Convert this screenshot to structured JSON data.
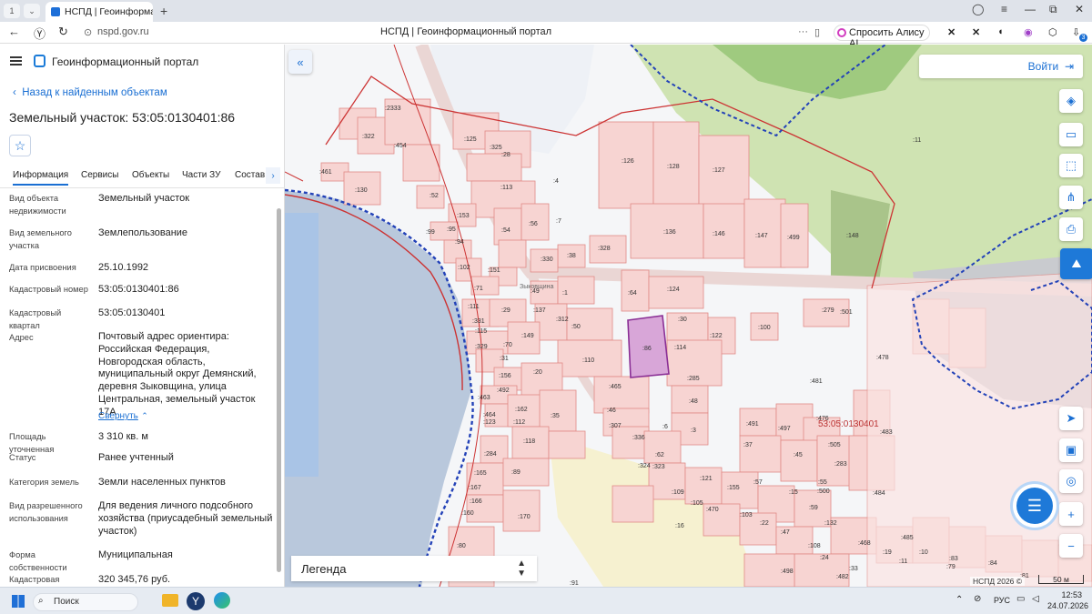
{
  "browser": {
    "tab_number": "1",
    "tab_title": "НСПД | Геоинформаци",
    "url": "nspd.gov.ru",
    "page_title": "НСПД | Геоинформационный портал",
    "alice_label": "Спросить Алису AI",
    "badge": "3"
  },
  "panel": {
    "portal_title": "Геоинформационный портал",
    "back_label": "Назад к найденным объектам",
    "object_title": "Земельный участок: 53:05:0130401:86",
    "tabs": [
      "Информация",
      "Сервисы",
      "Объекты",
      "Части ЗУ",
      "Состав"
    ],
    "fields": [
      {
        "label": "Вид объекта недвижимости",
        "value": "Земельный участок"
      },
      {
        "label": "Вид земельного участка",
        "value": "Землепользование"
      },
      {
        "label": "Дата присвоения",
        "value": "25.10.1992"
      },
      {
        "label": "Кадастровый номер",
        "value": "53:05:0130401:86"
      },
      {
        "label": "Кадастровый квартал",
        "value": "53:05:0130401"
      },
      {
        "label": "Адрес",
        "value": "Почтовый адрес ориентира: Российская Федерация, Новгородская область, муниципальный округ Демянский, деревня Зыковщина, улица Центральная, земельный участок 17А"
      },
      {
        "label": "Площадь уточненная",
        "value": "3 310 кв. м"
      },
      {
        "label": "Статус",
        "value": "Ранее учтенный"
      },
      {
        "label": "Категория земель",
        "value": "Земли населенных пунктов"
      },
      {
        "label": "Вид разрешенного использования",
        "value": "Для ведения личного подсобного хозяйства (приусадебный земельный участок)"
      },
      {
        "label": "Форма собственности",
        "value": "Муниципальная"
      },
      {
        "label": "Кадастровая",
        "value": "320 345,76 руб."
      }
    ],
    "collapse_label": "Свернуть"
  },
  "map": {
    "login_label": "Войти",
    "legend_label": "Легенда",
    "copyright": "НСПД 2026 ©",
    "scale": "50 м",
    "quarter_label": "53:05:0130401",
    "village_label": "Зыковщина",
    "parcels": [
      ":2333",
      ":322",
      ":454",
      ":125",
      ":325",
      ":28",
      ":461",
      ":130",
      ":113",
      ":4",
      ":126",
      ":128",
      ":127",
      ":11",
      ":52",
      ":153",
      ":56",
      ":7",
      ":99",
      ":95",
      ":54",
      ":94",
      ":136",
      ":146",
      ":147",
      ":499",
      ":148",
      ":328",
      ":330",
      ":38",
      ":102",
      ":151",
      ":71",
      ":49",
      ":1",
      ":64",
      ":124",
      ":279",
      ":501",
      ":111",
      ":331",
      ":29",
      ":137",
      ":312",
      ":50",
      ":30",
      ":122",
      ":100",
      ":115",
      ":329",
      ":149",
      ":70",
      ":31",
      ":86",
      ":114",
      ":478",
      ":110",
      ":156",
      ":20",
      ":285",
      ":481",
      ":492",
      ":465",
      ":463",
      ":162",
      ":48",
      ":46",
      ":35",
      ":464",
      ":123",
      ":112",
      ":307",
      ":6",
      ":3",
      ":491",
      ":497",
      ":476",
      ":118",
      ":336",
      ":37",
      ":45",
      ":505",
      ":483",
      ":284",
      ":62",
      ":324",
      ":323",
      ":283",
      ":89",
      ":165",
      ":121",
      ":57",
      ":55",
      ":167",
      ":109",
      ":155",
      ":500",
      ":484",
      ":166",
      ":105",
      ":470",
      ":15",
      ":160",
      ":170",
      ":103",
      ":22",
      ":59",
      ":132",
      ":16",
      ":47",
      ":108",
      ":468",
      ":485",
      ":80",
      ":24",
      ":19",
      ":10",
      ":11",
      ":83",
      ":79",
      ":84",
      ":33",
      ":498",
      ":482",
      ":81",
      ":91"
    ]
  },
  "taskbar": {
    "search_label": "Поиск",
    "lang": "РУС",
    "time": "12:53",
    "date": "24.07.2026"
  }
}
